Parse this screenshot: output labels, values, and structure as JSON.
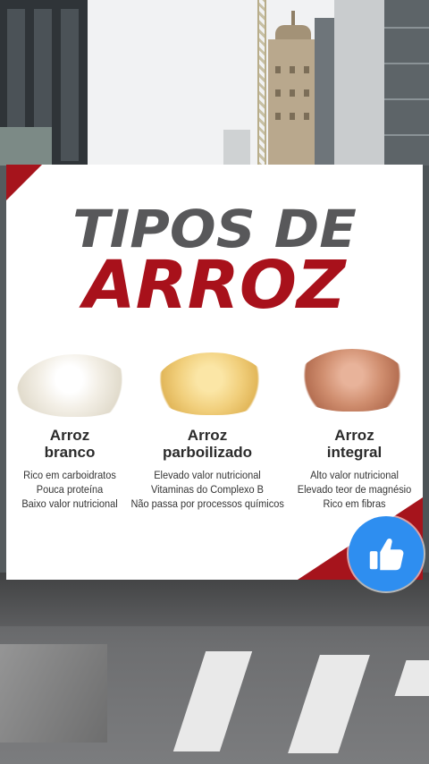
{
  "infographic": {
    "title_line1": "TIPOS DE",
    "title_line2": "ARROZ",
    "types": [
      {
        "name_line1": "Arroz",
        "name_line2": "branco",
        "points": [
          "Rico em carboidratos",
          "Pouca proteína",
          "Baixo valor nutricional"
        ]
      },
      {
        "name_line1": "Arroz",
        "name_line2": "parboilizado",
        "points": [
          "Elevado valor nutricional",
          "Vitaminas do Complexo B",
          "Não passa por processos químicos"
        ]
      },
      {
        "name_line1": "Arroz",
        "name_line2": "integral",
        "points": [
          "Alto valor nutricional",
          "Elevado teor de magnésio",
          "Rico em fibras"
        ]
      }
    ]
  },
  "icons": {
    "like": "thumbs-up-icon"
  },
  "colors": {
    "accent_red": "#a8111b",
    "title_gray": "#58585a",
    "like_blue": "#2e8ef0"
  }
}
